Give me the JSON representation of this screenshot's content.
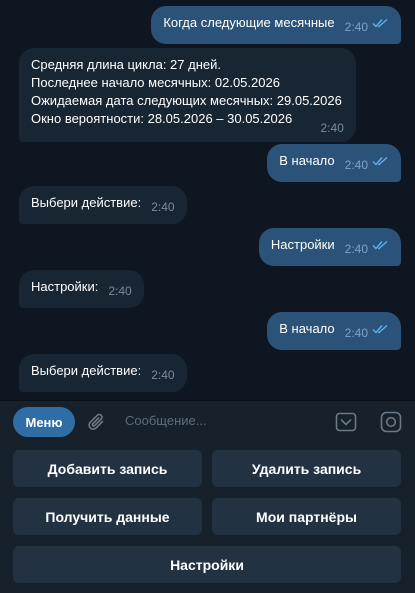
{
  "messages": [
    {
      "dir": "out",
      "text": "Когда следующие месячные",
      "time": "2:40"
    },
    {
      "dir": "in",
      "lines": [
        "Средняя длина цикла: 27 дней.",
        "Последнее начало месячных: 02.05.2026",
        "Ожидаемая дата следующих месячных: 29.05.2026",
        "Окно вероятности: 28.05.2026 – 30.05.2026"
      ],
      "time": "2:40"
    },
    {
      "dir": "out",
      "text": "В начало",
      "time": "2:40"
    },
    {
      "dir": "in",
      "text": "Выбери действие:",
      "time": "2:40"
    },
    {
      "dir": "out",
      "text": "Настройки",
      "time": "2:40"
    },
    {
      "dir": "in",
      "text": "Настройки:",
      "time": "2:40"
    },
    {
      "dir": "out",
      "text": "В начало",
      "time": "2:40"
    },
    {
      "dir": "in",
      "text": "Выбери действие:",
      "time": "2:40"
    }
  ],
  "composer": {
    "menu_label": "Меню",
    "placeholder": "Сообщение..."
  },
  "keyboard": {
    "add": "Добавить запись",
    "delete": "Удалить запись",
    "get": "Получить данные",
    "partners": "Мои партнёры",
    "settings": "Настройки"
  },
  "icons": {
    "attach": "paperclip-icon",
    "keyboard": "keyboard-toggle-icon",
    "instagram": "instagram-icon",
    "read": "double-check-icon"
  },
  "colors": {
    "background": "#0e1621",
    "incoming": "#182533",
    "outgoing": "#2b5278",
    "menu": "#2f6ea5",
    "button": "#233243"
  }
}
